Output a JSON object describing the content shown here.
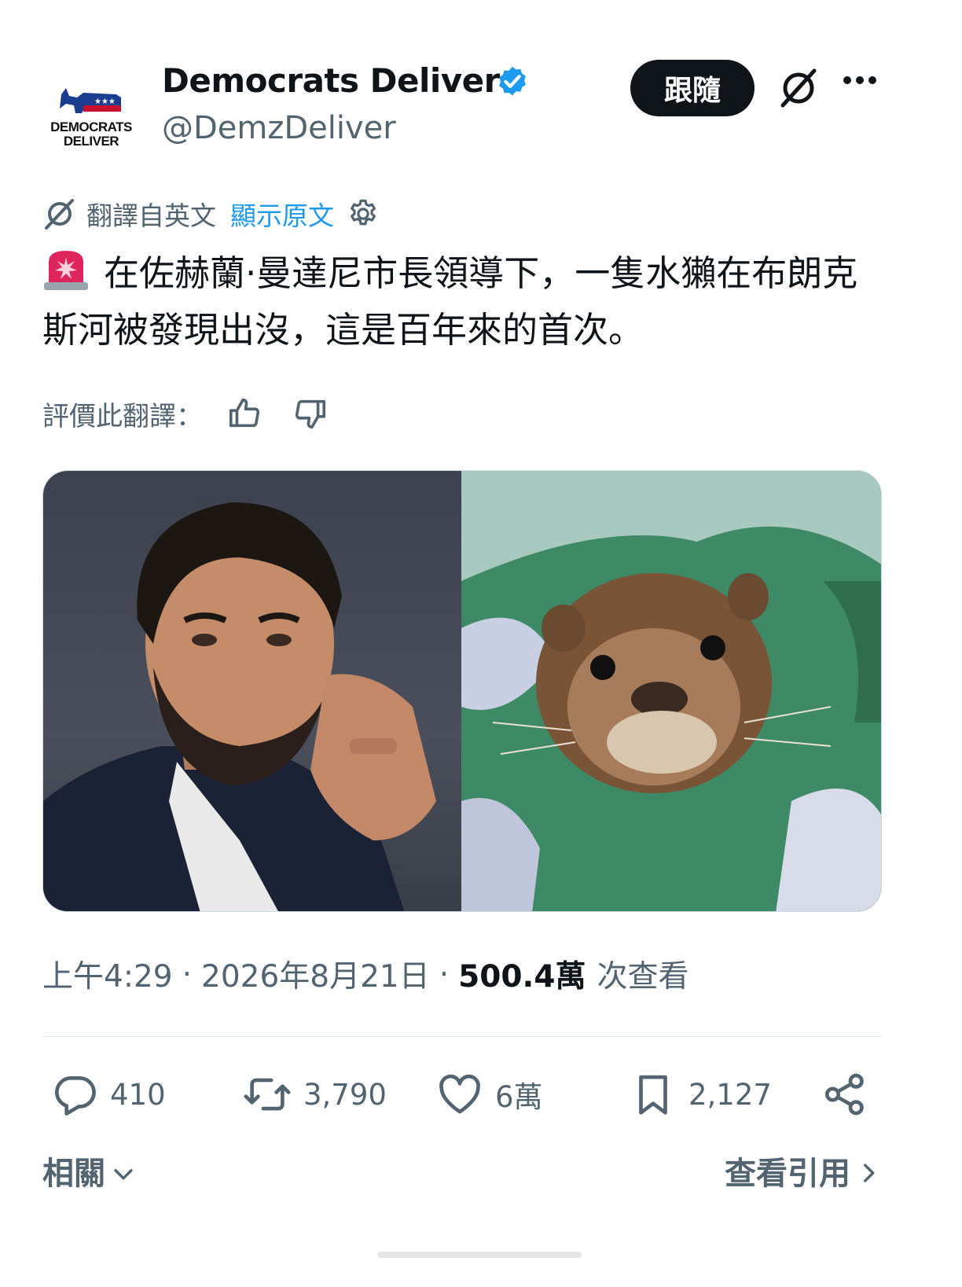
{
  "account": {
    "display_name": "Democrats Deliver",
    "handle": "@DemzDeliver",
    "avatar_line1": "DEMOCRATS",
    "avatar_line2": "DELIVER",
    "follow_label": "跟隨"
  },
  "translation": {
    "label": "翻譯自英文",
    "show_original": "顯示原文"
  },
  "tweet": {
    "text": "在佐赫蘭·曼達尼市長領導下，一隻水獺在布朗克斯河被發現出沒，這是百年來的首次。"
  },
  "rate": {
    "label": "評價此翻譯："
  },
  "meta": {
    "time": "上午4:29",
    "date": "2026年8月21日",
    "views_count": "500.4萬",
    "views_label": "次查看",
    "separator": "·"
  },
  "actions": {
    "replies": "410",
    "reposts": "3,790",
    "likes": "6萬",
    "bookmarks": "2,127"
  },
  "footer": {
    "related_label": "相關",
    "quotes_label": "查看引用"
  },
  "colors": {
    "accent": "#1d9bf0",
    "text_primary": "#0f1419",
    "text_secondary": "#536471",
    "follow_bg": "#0f1419"
  }
}
